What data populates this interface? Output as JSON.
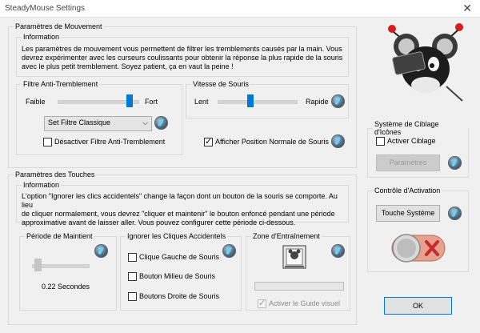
{
  "window": {
    "title": "SteadyMouse Settings",
    "close_glyph": "✕"
  },
  "movement": {
    "legend": "Paramètres de Mouvement",
    "info_legend": "Information",
    "info_lines": [
      "Les paramètres de mouvement vous permettent de filtrer les tremblements causés par la main. Vous",
      "devrez expérimenter avec les curseurs coulissants pour obtenir la réponse la plus rapide de la souris",
      "avec le plus petit tremblement. Soyez patient, ça en vaut la peine !"
    ],
    "filter": {
      "legend": "Filtre Anti-Tremblement",
      "min_label": "Faible",
      "max_label": "Fort",
      "level": 0.92,
      "preset_value": "Set Filtre Classique",
      "disable_label": "Désactiver Filtre Anti-Tremblement",
      "disable_checked": false
    },
    "speed": {
      "legend": "Vitesse de Souris",
      "min_label": "Lent",
      "max_label": "Rapide",
      "level": 0.4,
      "show_normal_label": "Afficher Position Normale de Souris",
      "show_normal_checked": true
    }
  },
  "buttons": {
    "legend": "Paramètres des Touches",
    "info_legend": "Information",
    "info_lines": [
      "L'option \"Ignorer les clics accidentels\" change la façon dont un bouton de la souris se comporte. Au lieu",
      "de cliquer normalement, vous devrez \"cliquer et maintenir\" le bouton enfoncé pendant une période",
      "approximative avant de laisser aller. Vous pouvez configurer cette période ci-dessous."
    ],
    "hold": {
      "legend": "Période de Maintient",
      "level": 0.05,
      "value_text": "0.22 Secondes"
    },
    "ignore": {
      "legend": "Ignorer les Cliques Accidentels",
      "left_label": "Clique Gauche de Souris",
      "middle_label": "Bouton Milieu de Souris",
      "right_label": "Boutons Droite de Souris"
    },
    "training": {
      "legend": "Zone d'Entraînement",
      "progress": 0,
      "guide_label": "Activer le Guide visuel",
      "guide_checked": true
    }
  },
  "targeting": {
    "legend": "Système de Ciblage d'Icônes",
    "enable_label": "Activer Ciblage",
    "enable_checked": false,
    "settings_button": "Paramètres"
  },
  "activation": {
    "legend": "Contrôle d'Activation",
    "hotkey_button": "Touche Système"
  },
  "footer": {
    "ok_button": "OK"
  },
  "colors": {
    "accent": "#0078d7",
    "toggle_x": "#c72b2b"
  }
}
